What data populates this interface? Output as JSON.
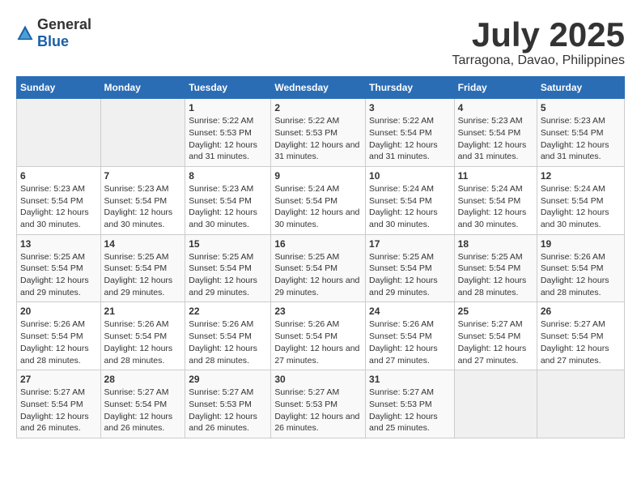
{
  "logo": {
    "text_general": "General",
    "text_blue": "Blue"
  },
  "title": "July 2025",
  "subtitle": "Tarragona, Davao, Philippines",
  "days_of_week": [
    "Sunday",
    "Monday",
    "Tuesday",
    "Wednesday",
    "Thursday",
    "Friday",
    "Saturday"
  ],
  "weeks": [
    [
      {
        "day": null,
        "info": null
      },
      {
        "day": null,
        "info": null
      },
      {
        "day": "1",
        "sunrise": "Sunrise: 5:22 AM",
        "sunset": "Sunset: 5:53 PM",
        "daylight": "Daylight: 12 hours and 31 minutes."
      },
      {
        "day": "2",
        "sunrise": "Sunrise: 5:22 AM",
        "sunset": "Sunset: 5:53 PM",
        "daylight": "Daylight: 12 hours and 31 minutes."
      },
      {
        "day": "3",
        "sunrise": "Sunrise: 5:22 AM",
        "sunset": "Sunset: 5:54 PM",
        "daylight": "Daylight: 12 hours and 31 minutes."
      },
      {
        "day": "4",
        "sunrise": "Sunrise: 5:23 AM",
        "sunset": "Sunset: 5:54 PM",
        "daylight": "Daylight: 12 hours and 31 minutes."
      },
      {
        "day": "5",
        "sunrise": "Sunrise: 5:23 AM",
        "sunset": "Sunset: 5:54 PM",
        "daylight": "Daylight: 12 hours and 31 minutes."
      }
    ],
    [
      {
        "day": "6",
        "sunrise": "Sunrise: 5:23 AM",
        "sunset": "Sunset: 5:54 PM",
        "daylight": "Daylight: 12 hours and 30 minutes."
      },
      {
        "day": "7",
        "sunrise": "Sunrise: 5:23 AM",
        "sunset": "Sunset: 5:54 PM",
        "daylight": "Daylight: 12 hours and 30 minutes."
      },
      {
        "day": "8",
        "sunrise": "Sunrise: 5:23 AM",
        "sunset": "Sunset: 5:54 PM",
        "daylight": "Daylight: 12 hours and 30 minutes."
      },
      {
        "day": "9",
        "sunrise": "Sunrise: 5:24 AM",
        "sunset": "Sunset: 5:54 PM",
        "daylight": "Daylight: 12 hours and 30 minutes."
      },
      {
        "day": "10",
        "sunrise": "Sunrise: 5:24 AM",
        "sunset": "Sunset: 5:54 PM",
        "daylight": "Daylight: 12 hours and 30 minutes."
      },
      {
        "day": "11",
        "sunrise": "Sunrise: 5:24 AM",
        "sunset": "Sunset: 5:54 PM",
        "daylight": "Daylight: 12 hours and 30 minutes."
      },
      {
        "day": "12",
        "sunrise": "Sunrise: 5:24 AM",
        "sunset": "Sunset: 5:54 PM",
        "daylight": "Daylight: 12 hours and 30 minutes."
      }
    ],
    [
      {
        "day": "13",
        "sunrise": "Sunrise: 5:25 AM",
        "sunset": "Sunset: 5:54 PM",
        "daylight": "Daylight: 12 hours and 29 minutes."
      },
      {
        "day": "14",
        "sunrise": "Sunrise: 5:25 AM",
        "sunset": "Sunset: 5:54 PM",
        "daylight": "Daylight: 12 hours and 29 minutes."
      },
      {
        "day": "15",
        "sunrise": "Sunrise: 5:25 AM",
        "sunset": "Sunset: 5:54 PM",
        "daylight": "Daylight: 12 hours and 29 minutes."
      },
      {
        "day": "16",
        "sunrise": "Sunrise: 5:25 AM",
        "sunset": "Sunset: 5:54 PM",
        "daylight": "Daylight: 12 hours and 29 minutes."
      },
      {
        "day": "17",
        "sunrise": "Sunrise: 5:25 AM",
        "sunset": "Sunset: 5:54 PM",
        "daylight": "Daylight: 12 hours and 29 minutes."
      },
      {
        "day": "18",
        "sunrise": "Sunrise: 5:25 AM",
        "sunset": "Sunset: 5:54 PM",
        "daylight": "Daylight: 12 hours and 28 minutes."
      },
      {
        "day": "19",
        "sunrise": "Sunrise: 5:26 AM",
        "sunset": "Sunset: 5:54 PM",
        "daylight": "Daylight: 12 hours and 28 minutes."
      }
    ],
    [
      {
        "day": "20",
        "sunrise": "Sunrise: 5:26 AM",
        "sunset": "Sunset: 5:54 PM",
        "daylight": "Daylight: 12 hours and 28 minutes."
      },
      {
        "day": "21",
        "sunrise": "Sunrise: 5:26 AM",
        "sunset": "Sunset: 5:54 PM",
        "daylight": "Daylight: 12 hours and 28 minutes."
      },
      {
        "day": "22",
        "sunrise": "Sunrise: 5:26 AM",
        "sunset": "Sunset: 5:54 PM",
        "daylight": "Daylight: 12 hours and 28 minutes."
      },
      {
        "day": "23",
        "sunrise": "Sunrise: 5:26 AM",
        "sunset": "Sunset: 5:54 PM",
        "daylight": "Daylight: 12 hours and 27 minutes."
      },
      {
        "day": "24",
        "sunrise": "Sunrise: 5:26 AM",
        "sunset": "Sunset: 5:54 PM",
        "daylight": "Daylight: 12 hours and 27 minutes."
      },
      {
        "day": "25",
        "sunrise": "Sunrise: 5:27 AM",
        "sunset": "Sunset: 5:54 PM",
        "daylight": "Daylight: 12 hours and 27 minutes."
      },
      {
        "day": "26",
        "sunrise": "Sunrise: 5:27 AM",
        "sunset": "Sunset: 5:54 PM",
        "daylight": "Daylight: 12 hours and 27 minutes."
      }
    ],
    [
      {
        "day": "27",
        "sunrise": "Sunrise: 5:27 AM",
        "sunset": "Sunset: 5:54 PM",
        "daylight": "Daylight: 12 hours and 26 minutes."
      },
      {
        "day": "28",
        "sunrise": "Sunrise: 5:27 AM",
        "sunset": "Sunset: 5:54 PM",
        "daylight": "Daylight: 12 hours and 26 minutes."
      },
      {
        "day": "29",
        "sunrise": "Sunrise: 5:27 AM",
        "sunset": "Sunset: 5:53 PM",
        "daylight": "Daylight: 12 hours and 26 minutes."
      },
      {
        "day": "30",
        "sunrise": "Sunrise: 5:27 AM",
        "sunset": "Sunset: 5:53 PM",
        "daylight": "Daylight: 12 hours and 26 minutes."
      },
      {
        "day": "31",
        "sunrise": "Sunrise: 5:27 AM",
        "sunset": "Sunset: 5:53 PM",
        "daylight": "Daylight: 12 hours and 25 minutes."
      },
      {
        "day": null,
        "info": null
      },
      {
        "day": null,
        "info": null
      }
    ]
  ]
}
